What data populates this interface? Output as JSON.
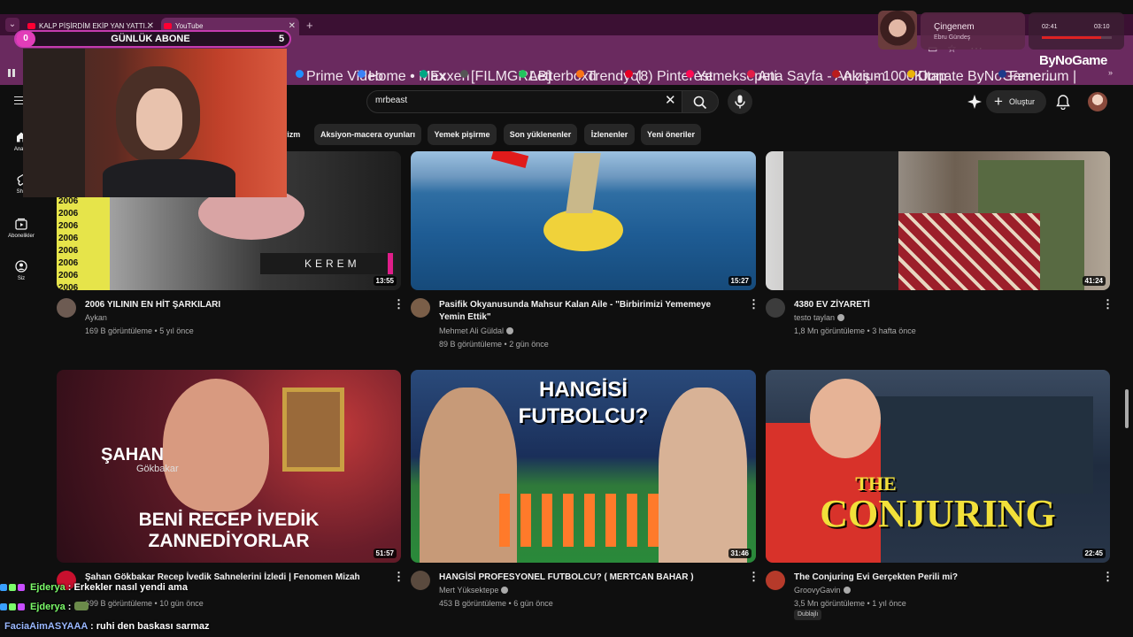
{
  "browser": {
    "tabs": [
      {
        "label": "KALP PİŞİRDİM EKİP YAN YATTI..."
      },
      {
        "label": "YouTube"
      }
    ],
    "bookmarks": [
      "Prime Video",
      "Home • Max",
      "Exxen",
      "[FILMGRAB]",
      "Letterboxd",
      "Trendyol",
      "(8) Pinterest",
      "Yemeksepeti",
      "Ana Sayfa - Anizium",
      "Akış - 1000Kitap",
      "Donate ByNoGame...",
      "Fenerium | Fenerba..."
    ],
    "bookmark_colors": [
      "#1e90ff",
      "#3b82f6",
      "#00a884",
      "#555555",
      "#22c55e",
      "#f97316",
      "#e60023",
      "#ff0a54",
      "#e11d48",
      "#b91c1c",
      "#eab308",
      "#1e3a8a"
    ]
  },
  "youtube": {
    "search_query": "mrbeast",
    "create_label": "Oluştur",
    "sidebar": [
      "Ana S",
      "Sho",
      "Abonelikler",
      "Siz"
    ],
    "chips": [
      "rizm",
      "Aksiyon-macera oyunları",
      "Yemek pişirme",
      "Son yüklenenler",
      "İzlenenler",
      "Yeni öneriler"
    ],
    "videos": [
      {
        "title": "2006 YILININ EN HİT ŞARKILARI",
        "channel": "Aykan",
        "meta": "169 B görüntüleme • 5 yıl önce",
        "duration": "13:55"
      },
      {
        "title": "Pasifik Okyanusunda Mahsur Kalan Aile - \"Birbirimizi Yememeye Yemin Ettik\"",
        "channel": "Mehmet Ali Güldal",
        "meta": "89 B görüntüleme • 2 gün önce",
        "duration": "15:27"
      },
      {
        "title": "4380 EV ZİYARETİ",
        "channel": "testo taylan",
        "meta": "1,8 Mn görüntüleme • 3 hafta önce",
        "duration": "41:24"
      },
      {
        "title": "Şahan Gökbakar Recep İvedik Sahnelerini İzledi | Fenomen Mizah",
        "channel": "",
        "meta": "699 B görüntüleme • 10 gün önce",
        "duration": "51:57"
      },
      {
        "title": "HANGİSİ PROFESYONEL FUTBOLCU? ( MERTCAN BAHAR )",
        "channel": "Mert Yüksektepe",
        "meta": "453 B görüntüleme • 6 gün önce",
        "duration": "31:46"
      },
      {
        "title": "The Conjuring Evi Gerçekten Perili mi?",
        "channel": "GroovyGavin",
        "meta": "3,5 Mn görüntüleme • 1 yıl önce",
        "duration": "22:45",
        "badge": "Dublajlı"
      }
    ],
    "thumb_text": {
      "t1_strip": "2006",
      "t1_caption": "KEREM",
      "t4_name": "ŞAHAN",
      "t4_sub": "Gökbakar",
      "t4_line1": "BENİ RECEP İVEDİK",
      "t4_line2": "ZANNEDİYORLAR",
      "t5_line1": "HANGİSİ",
      "t5_line2": "FUTBOLCU?",
      "t6_line1": "THE",
      "t6_line2": "CONJURING"
    }
  },
  "overlay": {
    "sub_goal_label": "GÜNLÜK ABONE",
    "sub_count": "0",
    "sub_target": "5",
    "song_title": "Çingenem",
    "song_artist": "Ebru Gündeş",
    "time_current": "02:41",
    "time_total": "03:10",
    "progress": 0.85,
    "brand": "ByNoGame",
    "chat": [
      {
        "user": "Ejderya",
        "msg": "Erkekler nasıl yendi ama",
        "color": "#7cfc6a"
      },
      {
        "user": "Ejderya",
        "msg": "",
        "color": "#7cfc6a"
      },
      {
        "user": "FaciaAimASYAAA",
        "msg": "ruhi den baskası sarmaz",
        "color": "#9ab8ff"
      }
    ]
  }
}
